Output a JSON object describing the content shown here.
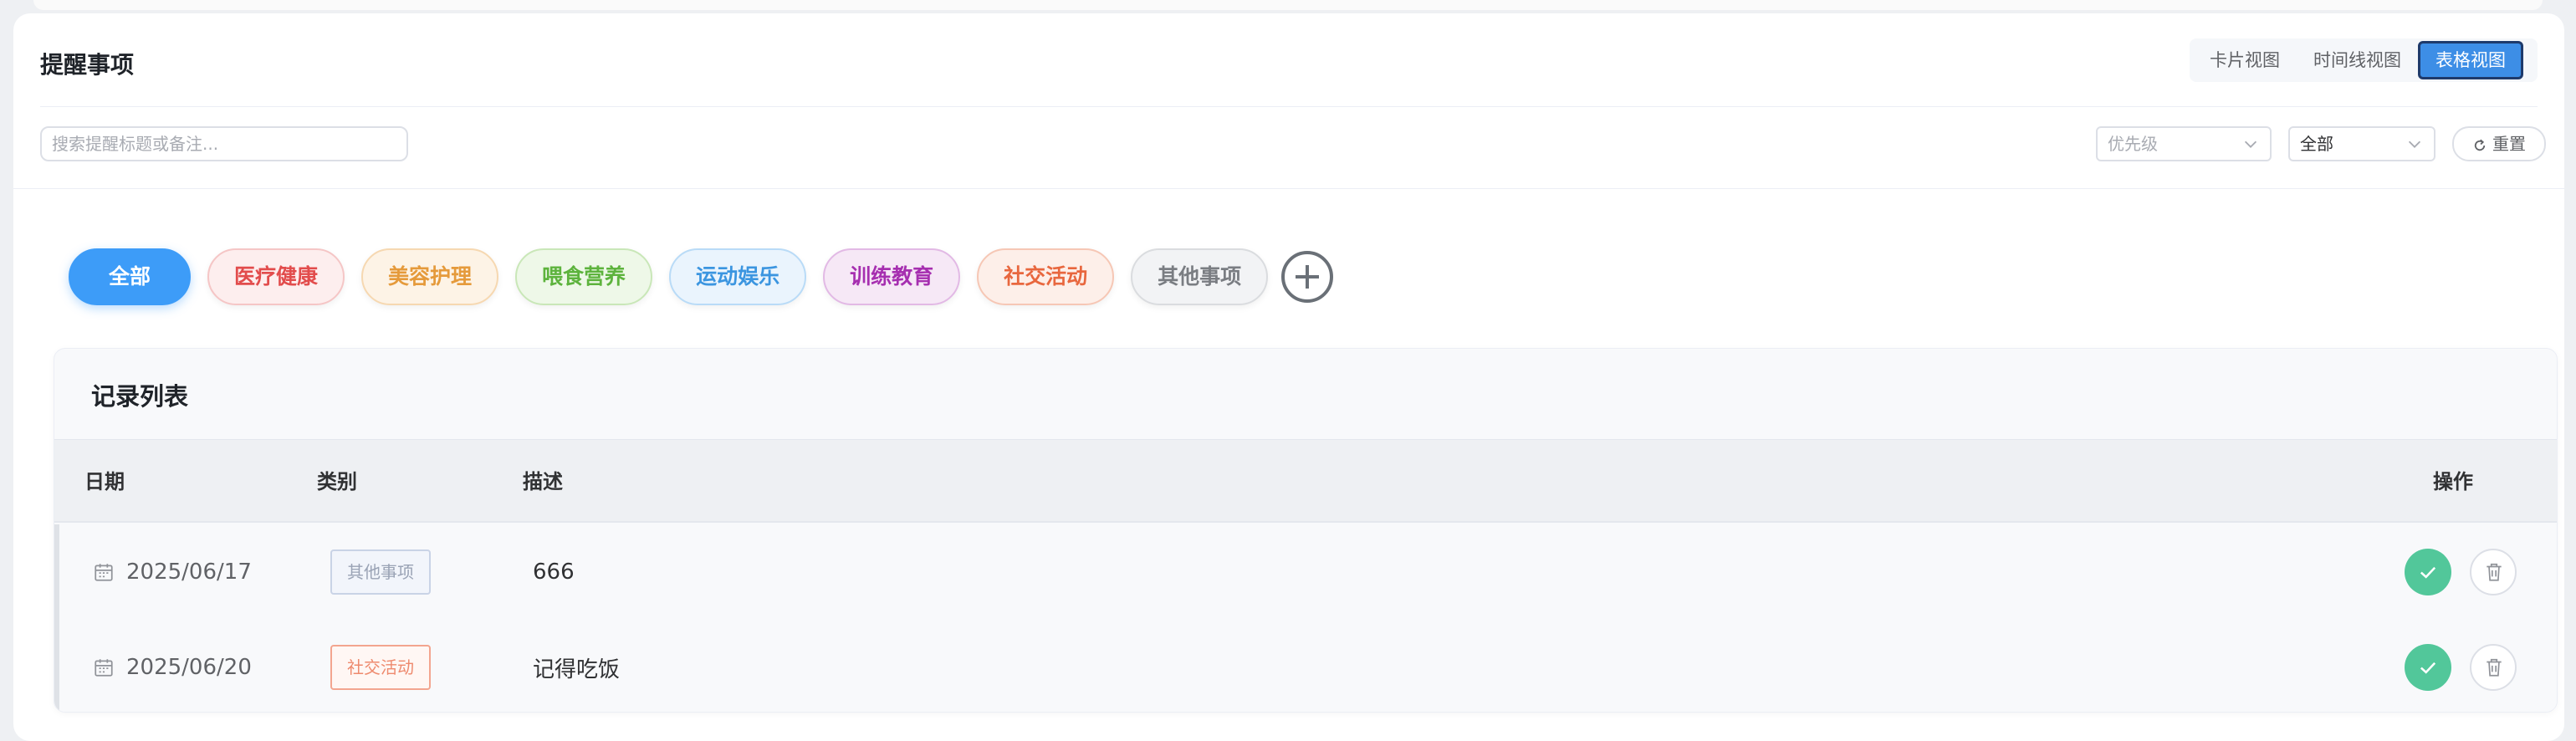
{
  "header": {
    "title": "提醒事项",
    "views": [
      {
        "label": "卡片视图",
        "active": false
      },
      {
        "label": "时间线视图",
        "active": false
      },
      {
        "label": "表格视图",
        "active": true
      }
    ]
  },
  "filters": {
    "search_placeholder": "搜索提醒标题或备注...",
    "priority_placeholder": "优先级",
    "status_value": "全部",
    "reset_label": "重置"
  },
  "categories": [
    {
      "label": "全部",
      "active": true
    },
    {
      "label": "医疗健康"
    },
    {
      "label": "美容护理"
    },
    {
      "label": "喂食营养"
    },
    {
      "label": "运动娱乐"
    },
    {
      "label": "训练教育"
    },
    {
      "label": "社交活动"
    },
    {
      "label": "其他事项"
    }
  ],
  "records": {
    "title": "记录列表",
    "columns": {
      "date": "日期",
      "category": "类别",
      "description": "描述",
      "actions": "操作"
    },
    "rows": [
      {
        "date": "2025/06/17",
        "category": "其他事项",
        "description": "666"
      },
      {
        "date": "2025/06/20",
        "category": "社交活动",
        "description": "记得吃饭"
      }
    ]
  },
  "icons": {
    "calendar": "calendar-icon",
    "check": "check-icon",
    "trash": "trash-icon",
    "refresh": "refresh-icon",
    "plus": "plus-icon",
    "chevron": "chevron-down-icon"
  },
  "colors": {
    "accent": "#3d9cf8",
    "success": "#52c79a"
  }
}
